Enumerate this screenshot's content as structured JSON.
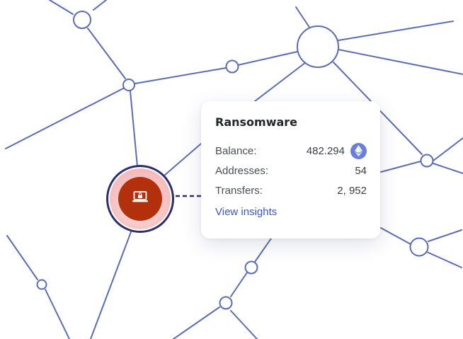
{
  "card": {
    "title": "Ransomware",
    "rows": [
      {
        "label": "Balance:",
        "value": "482.294"
      },
      {
        "label": "Addresses:",
        "value": "54"
      },
      {
        "label": "Transfers:",
        "value": "2, 952"
      }
    ],
    "link": "View insights"
  },
  "icons": {
    "balance_currency": "ethereum-icon",
    "node": "laptop-lock-icon"
  },
  "colors": {
    "edge": "#5b6cb5",
    "node_core": "#b3300c",
    "node_ring": "#2c2f6b",
    "link": "#3a56c8",
    "ethereum": "#6a7fdb"
  }
}
